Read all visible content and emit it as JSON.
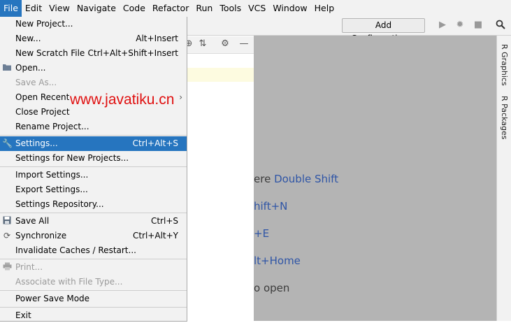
{
  "menubar": {
    "items": [
      "File",
      "Edit",
      "View",
      "Navigate",
      "Code",
      "Refactor",
      "Run",
      "Tools",
      "VCS",
      "Window",
      "Help"
    ],
    "active": "File"
  },
  "toolbar": {
    "add_configuration": "Add Configuration...",
    "icons": [
      "run-icon",
      "debug-icon",
      "stop-icon",
      "search-icon"
    ]
  },
  "panel_head_icons": [
    "target-icon",
    "collapse-icon",
    "gear-icon",
    "minimize-icon"
  ],
  "file_menu": {
    "items": [
      {
        "label": "New Project...",
        "shortcut": "",
        "icon": "",
        "disabled": false
      },
      {
        "label": "New...",
        "shortcut": "Alt+Insert",
        "icon": "",
        "disabled": false
      },
      {
        "label": "New Scratch File",
        "shortcut": "Ctrl+Alt+Shift+Insert",
        "icon": "",
        "disabled": false
      },
      {
        "label": "Open...",
        "shortcut": "",
        "icon": "folder-icon",
        "disabled": false
      },
      {
        "label": "Save As...",
        "shortcut": "",
        "icon": "",
        "disabled": true
      },
      {
        "label": "Open Recent",
        "shortcut": "",
        "icon": "",
        "disabled": false,
        "submenu": true
      },
      {
        "label": "Close Project",
        "shortcut": "",
        "icon": "",
        "disabled": false
      },
      {
        "label": "Rename Project...",
        "shortcut": "",
        "icon": "",
        "disabled": false
      },
      {
        "label": "Settings...",
        "shortcut": "Ctrl+Alt+S",
        "icon": "wrench-icon",
        "disabled": false,
        "selected": true
      },
      {
        "label": "Settings for New Projects...",
        "shortcut": "",
        "icon": "",
        "disabled": false
      },
      {
        "label": "Import Settings...",
        "shortcut": "",
        "icon": "",
        "disabled": false
      },
      {
        "label": "Export Settings...",
        "shortcut": "",
        "icon": "",
        "disabled": false
      },
      {
        "label": "Settings Repository...",
        "shortcut": "",
        "icon": "",
        "disabled": false
      },
      {
        "label": "Save All",
        "shortcut": "Ctrl+S",
        "icon": "save-icon",
        "disabled": false
      },
      {
        "label": "Synchronize",
        "shortcut": "Ctrl+Alt+Y",
        "icon": "sync-icon",
        "disabled": false
      },
      {
        "label": "Invalidate Caches / Restart...",
        "shortcut": "",
        "icon": "",
        "disabled": false
      },
      {
        "label": "Print...",
        "shortcut": "",
        "icon": "print-icon",
        "disabled": true
      },
      {
        "label": "Associate with File Type...",
        "shortcut": "",
        "icon": "",
        "disabled": true
      },
      {
        "label": "Power Save Mode",
        "shortcut": "",
        "icon": "",
        "disabled": false
      },
      {
        "label": "Exit",
        "shortcut": "",
        "icon": "",
        "disabled": false
      }
    ]
  },
  "watermark": "www.javatiku.cn",
  "editor_hints": [
    {
      "text": "ere ",
      "key": "Double Shift"
    },
    {
      "text": "",
      "key": "hift+N"
    },
    {
      "text": "",
      "key": "+E"
    },
    {
      "text": "",
      "key": "lt+Home"
    },
    {
      "text": "o open",
      "key": ""
    }
  ],
  "right_tabs": [
    "R Graphics",
    "R Packages"
  ],
  "colors": {
    "accent": "#2675bf",
    "watermark": "#e01010",
    "hint_key": "#2f55a6",
    "editor_bg": "#b4b4b4"
  }
}
